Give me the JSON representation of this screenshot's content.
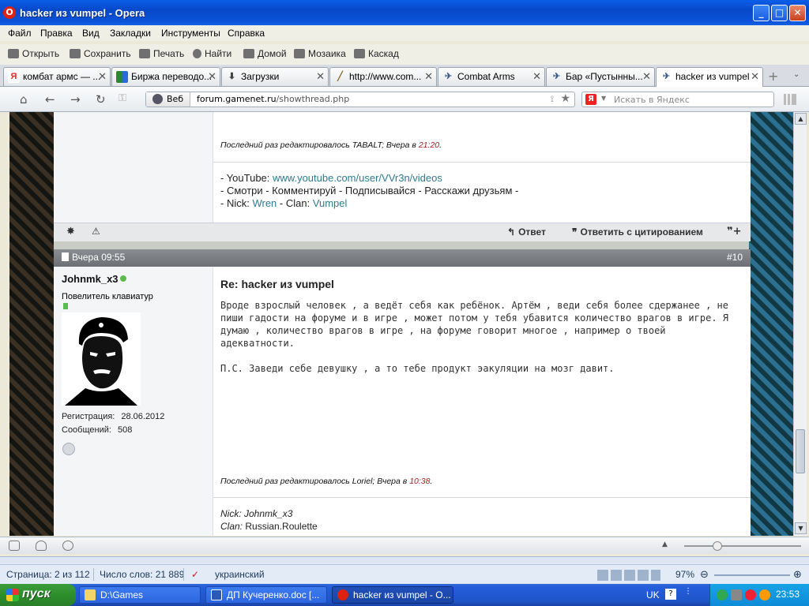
{
  "window": {
    "title": "hacker из vumpel - Opera"
  },
  "menu": [
    "Файл",
    "Правка",
    "Вид",
    "Закладки",
    "Инструменты",
    "Справка"
  ],
  "toolbar": {
    "open": "Открыть",
    "save": "Сохранить",
    "print": "Печать",
    "find": "Найти",
    "home": "Домой",
    "tile": "Мозаика",
    "cascade": "Каскад"
  },
  "tabs": [
    {
      "label": "комбат армс — ...",
      "icon": "yandex-icon"
    },
    {
      "label": "Биржа переводо...",
      "icon": "exchange-icon"
    },
    {
      "label": "Загрузки",
      "icon": "downloads-icon"
    },
    {
      "label": "http://www.com...",
      "icon": "pen-icon"
    },
    {
      "label": "Combat Arms",
      "icon": "combat-arms-icon"
    },
    {
      "label": "Бар «Пустынны...",
      "icon": "combat-arms-icon"
    },
    {
      "label": "hacker из vumpel",
      "icon": "combat-arms-icon",
      "active": true
    }
  ],
  "address": {
    "badge": "Веб",
    "url_domain": "forum.gamenet.ru",
    "url_path": "/showthread.php",
    "search_placeholder": "Искать в Яндекс",
    "search_engine_letter": "Я"
  },
  "post_prev": {
    "edited_prefix": "Последний раз редактировалось TABALT; Вчера в ",
    "edited_time": "21:20",
    "edited_suffix": ".",
    "sig_line1_label": "- YouTube: ",
    "sig_line1_link": "www.youtube.com/user/VVr3n/videos",
    "sig_line2": "- Смотри - Комментируй - Подписывайся - Расскажи друзьям -",
    "sig_line3_label": "- Nick: ",
    "sig_nick": "Wren",
    "sig_clan_label": " - Clan: ",
    "sig_clan": "Vumpel"
  },
  "actions": {
    "reply": "Ответ",
    "quote": "Ответить с цитированием"
  },
  "post": {
    "date": "Вчера 09:55",
    "number": "#10",
    "username": "Johnmk_x3",
    "user_title": "Повелитель клавиатур",
    "reg_label": "Регистрация:",
    "reg_value": "28.06.2012",
    "posts_label": "Сообщений:",
    "posts_value": "508",
    "title": "Re: hacker из vumpel",
    "body_p1": "Вроде взрослый человек , а ведёт себя как ребёнок. Артём , веди себя более сдержанее , не пиши гадости на форуме и в игре , может потом у тебя убавится количество врагов в игре. Я думаю , количество врагов в игре , на форуме говорит многое , например о твоей адекватности.",
    "body_p2": "П.С. Заведи себе девушку , а то тебе продукт эакуляции на мозг давит.",
    "edited_prefix": "Последний раз редактировалось Loriel; Вчера в ",
    "edited_time": "10:38",
    "edited_suffix": ".",
    "sig_nick_label": "Nick:",
    "sig_nick": " Johnmk_x3",
    "sig_clan_label": "Clan:",
    "sig_clan": " Russian.Roulette"
  },
  "opera_status": {
    "zoom": "97%"
  },
  "word_status": {
    "page": "Страница: 2 из 112",
    "words": "Число слов: 21 889",
    "language": "украинский",
    "zoom": "97%"
  },
  "taskbar": {
    "start": "пуск",
    "tasks": [
      {
        "label": "D:\\Games"
      },
      {
        "label": "ДП Кучеренко.doc [..."
      },
      {
        "label": "hacker из vumpel - O...",
        "active": true
      }
    ],
    "lang": "UK",
    "time": "23:53"
  }
}
